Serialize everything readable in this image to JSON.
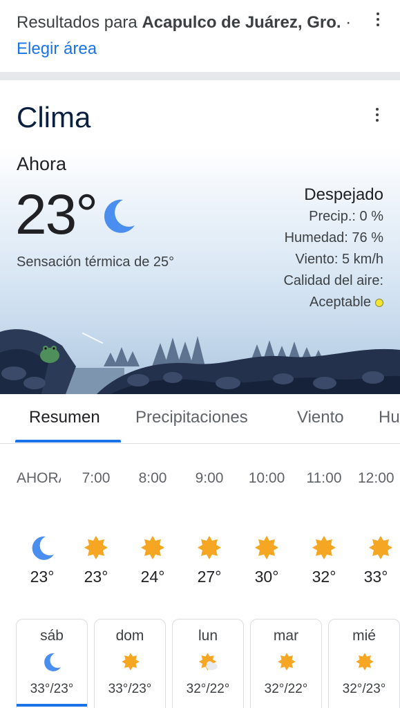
{
  "header": {
    "prefix": "Resultados para ",
    "location": "Acapulco de Juárez, Gro.",
    "separator": " · ",
    "change_area": "Elegir área"
  },
  "weather": {
    "title": "Clima",
    "now_label": "Ahora",
    "temperature": "23°",
    "feels_like": "Sensación térmica de 25°",
    "condition": "Despejado",
    "precip": "Precip.: 0 %",
    "humidity": "Humedad: 76 %",
    "wind": "Viento: 5 km/h",
    "air_quality_label": "Calidad del aire:",
    "air_quality_value": "Aceptable",
    "air_quality_color": "#f3e532",
    "current_icon": "moon-icon"
  },
  "tabs": [
    {
      "label": "Resumen",
      "active": true
    },
    {
      "label": "Precipitaciones",
      "active": false
    },
    {
      "label": "Viento",
      "active": false
    },
    {
      "label": "Humedad",
      "active": false
    }
  ],
  "hourly": [
    {
      "time": "AHORA",
      "icon": "moon-icon",
      "temp": "23°"
    },
    {
      "time": "7:00",
      "icon": "sun-icon",
      "temp": "23°"
    },
    {
      "time": "8:00",
      "icon": "sun-icon",
      "temp": "24°"
    },
    {
      "time": "9:00",
      "icon": "sun-icon",
      "temp": "27°"
    },
    {
      "time": "10:00",
      "icon": "sun-icon",
      "temp": "30°"
    },
    {
      "time": "11:00",
      "icon": "sun-icon",
      "temp": "32°"
    },
    {
      "time": "12:00",
      "icon": "sun-icon",
      "temp": "33°"
    }
  ],
  "daily": [
    {
      "day": "sáb",
      "icon": "moon-icon",
      "range": "33°/23°",
      "active": true
    },
    {
      "day": "dom",
      "icon": "sun-icon",
      "range": "33°/23°",
      "active": false
    },
    {
      "day": "lun",
      "icon": "partly-cloudy-icon",
      "range": "32°/22°",
      "active": false
    },
    {
      "day": "mar",
      "icon": "sun-icon",
      "range": "32°/22°",
      "active": false
    },
    {
      "day": "mié",
      "icon": "sun-icon",
      "range": "32°/23°",
      "active": false
    }
  ],
  "colors": {
    "accent": "#1a73e8",
    "sun": "#f5a623",
    "moon": "#4285f4"
  }
}
